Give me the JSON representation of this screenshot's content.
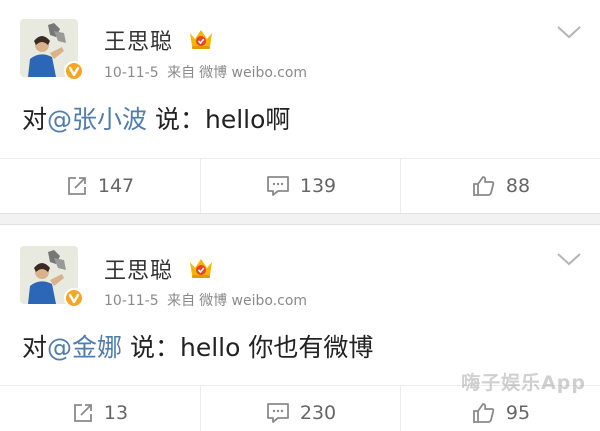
{
  "posts": [
    {
      "author": "王思聪",
      "date": "10-11-5",
      "source_prefix": "来自",
      "source": "微博 weibo.com",
      "text_prefix": "对",
      "mention": "@张小波",
      "text_suffix": " 说：hello啊",
      "reposts": "147",
      "comments": "139",
      "likes": "88"
    },
    {
      "author": "王思聪",
      "date": "10-11-5",
      "source_prefix": "来自",
      "source": "微博 weibo.com",
      "text_prefix": "对",
      "mention": "@金娜",
      "text_suffix": " 说：hello 你也有微博",
      "reposts": "13",
      "comments": "230",
      "likes": "95"
    }
  ],
  "watermark": "嗨子娱乐App",
  "colors": {
    "mention": "#507daf",
    "verified_badge": "#f6a623",
    "vip_crown": "#f7b500",
    "icon_gray": "#8a8a8a"
  },
  "icons": [
    "avatar",
    "verified-badge-icon",
    "vip-crown-icon",
    "chevron-down-icon",
    "repost-icon",
    "comment-icon",
    "like-icon"
  ]
}
